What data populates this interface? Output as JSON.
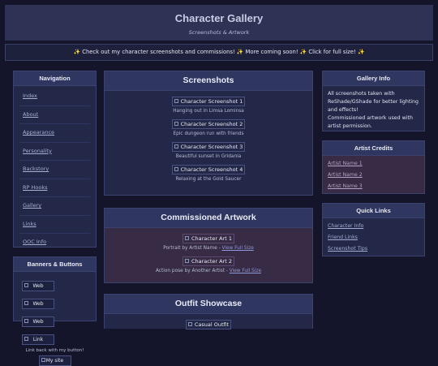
{
  "header": {
    "title": "Character Gallery",
    "subtitle": "Screenshots & Artwork"
  },
  "announcement": "✨ Check out my character screenshots and commissions! ✨ More coming soon! ✨ Click for full size! ✨",
  "navigation": {
    "title": "Navigation",
    "items": [
      "Index",
      "About",
      "Appearance",
      "Personality",
      "Backstory",
      "RP Hooks",
      "Gallery",
      "Links",
      "OOC Info"
    ]
  },
  "banners": {
    "title": "Banners & Buttons",
    "items": [
      "Web",
      "Web",
      "Web",
      "Link"
    ],
    "caption": "Link back with my button!",
    "my_site": "My site"
  },
  "screenshots": {
    "title": "Screenshots",
    "items": [
      {
        "alt": "Character Screenshot 1",
        "caption": "Hanging out in Limsa Lominsa"
      },
      {
        "alt": "Character Screenshot 2",
        "caption": "Epic dungeon run with friends"
      },
      {
        "alt": "Character Screenshot 3",
        "caption": "Beautiful sunset in Gridania"
      },
      {
        "alt": "Character Screenshot 4",
        "caption": "Relaxing at the Gold Saucer"
      }
    ]
  },
  "commissioned": {
    "title": "Commissioned Artwork",
    "view_label": "View Full Size",
    "items": [
      {
        "alt": "Character Art 1",
        "caption": "Portrait by Artist Name - "
      },
      {
        "alt": "Character Art 2",
        "caption": "Action pose by Another Artist - "
      }
    ]
  },
  "outfits": {
    "title": "Outfit Showcase",
    "items": [
      {
        "alt": "Casual Outfit"
      }
    ]
  },
  "gallery_info": {
    "title": "Gallery Info",
    "text": "All screenshots taken with ReShade/GShade for better lighting and effects!",
    "text2": "Commissioned artwork used with artist permission."
  },
  "artist_credits": {
    "title": "Artist Credits",
    "items": [
      "Artist Name 1",
      "Artist Name 2",
      "Artist Name 3"
    ]
  },
  "quick_links": {
    "title": "Quick Links",
    "items": [
      "Character Info",
      "Friend Links",
      "Screenshot Tips"
    ]
  },
  "colors": {
    "background": "#14152a",
    "panel": "#232848",
    "panel_header": "#2f3660",
    "commission_bg": "#372b45",
    "link": "#a6acd3"
  }
}
